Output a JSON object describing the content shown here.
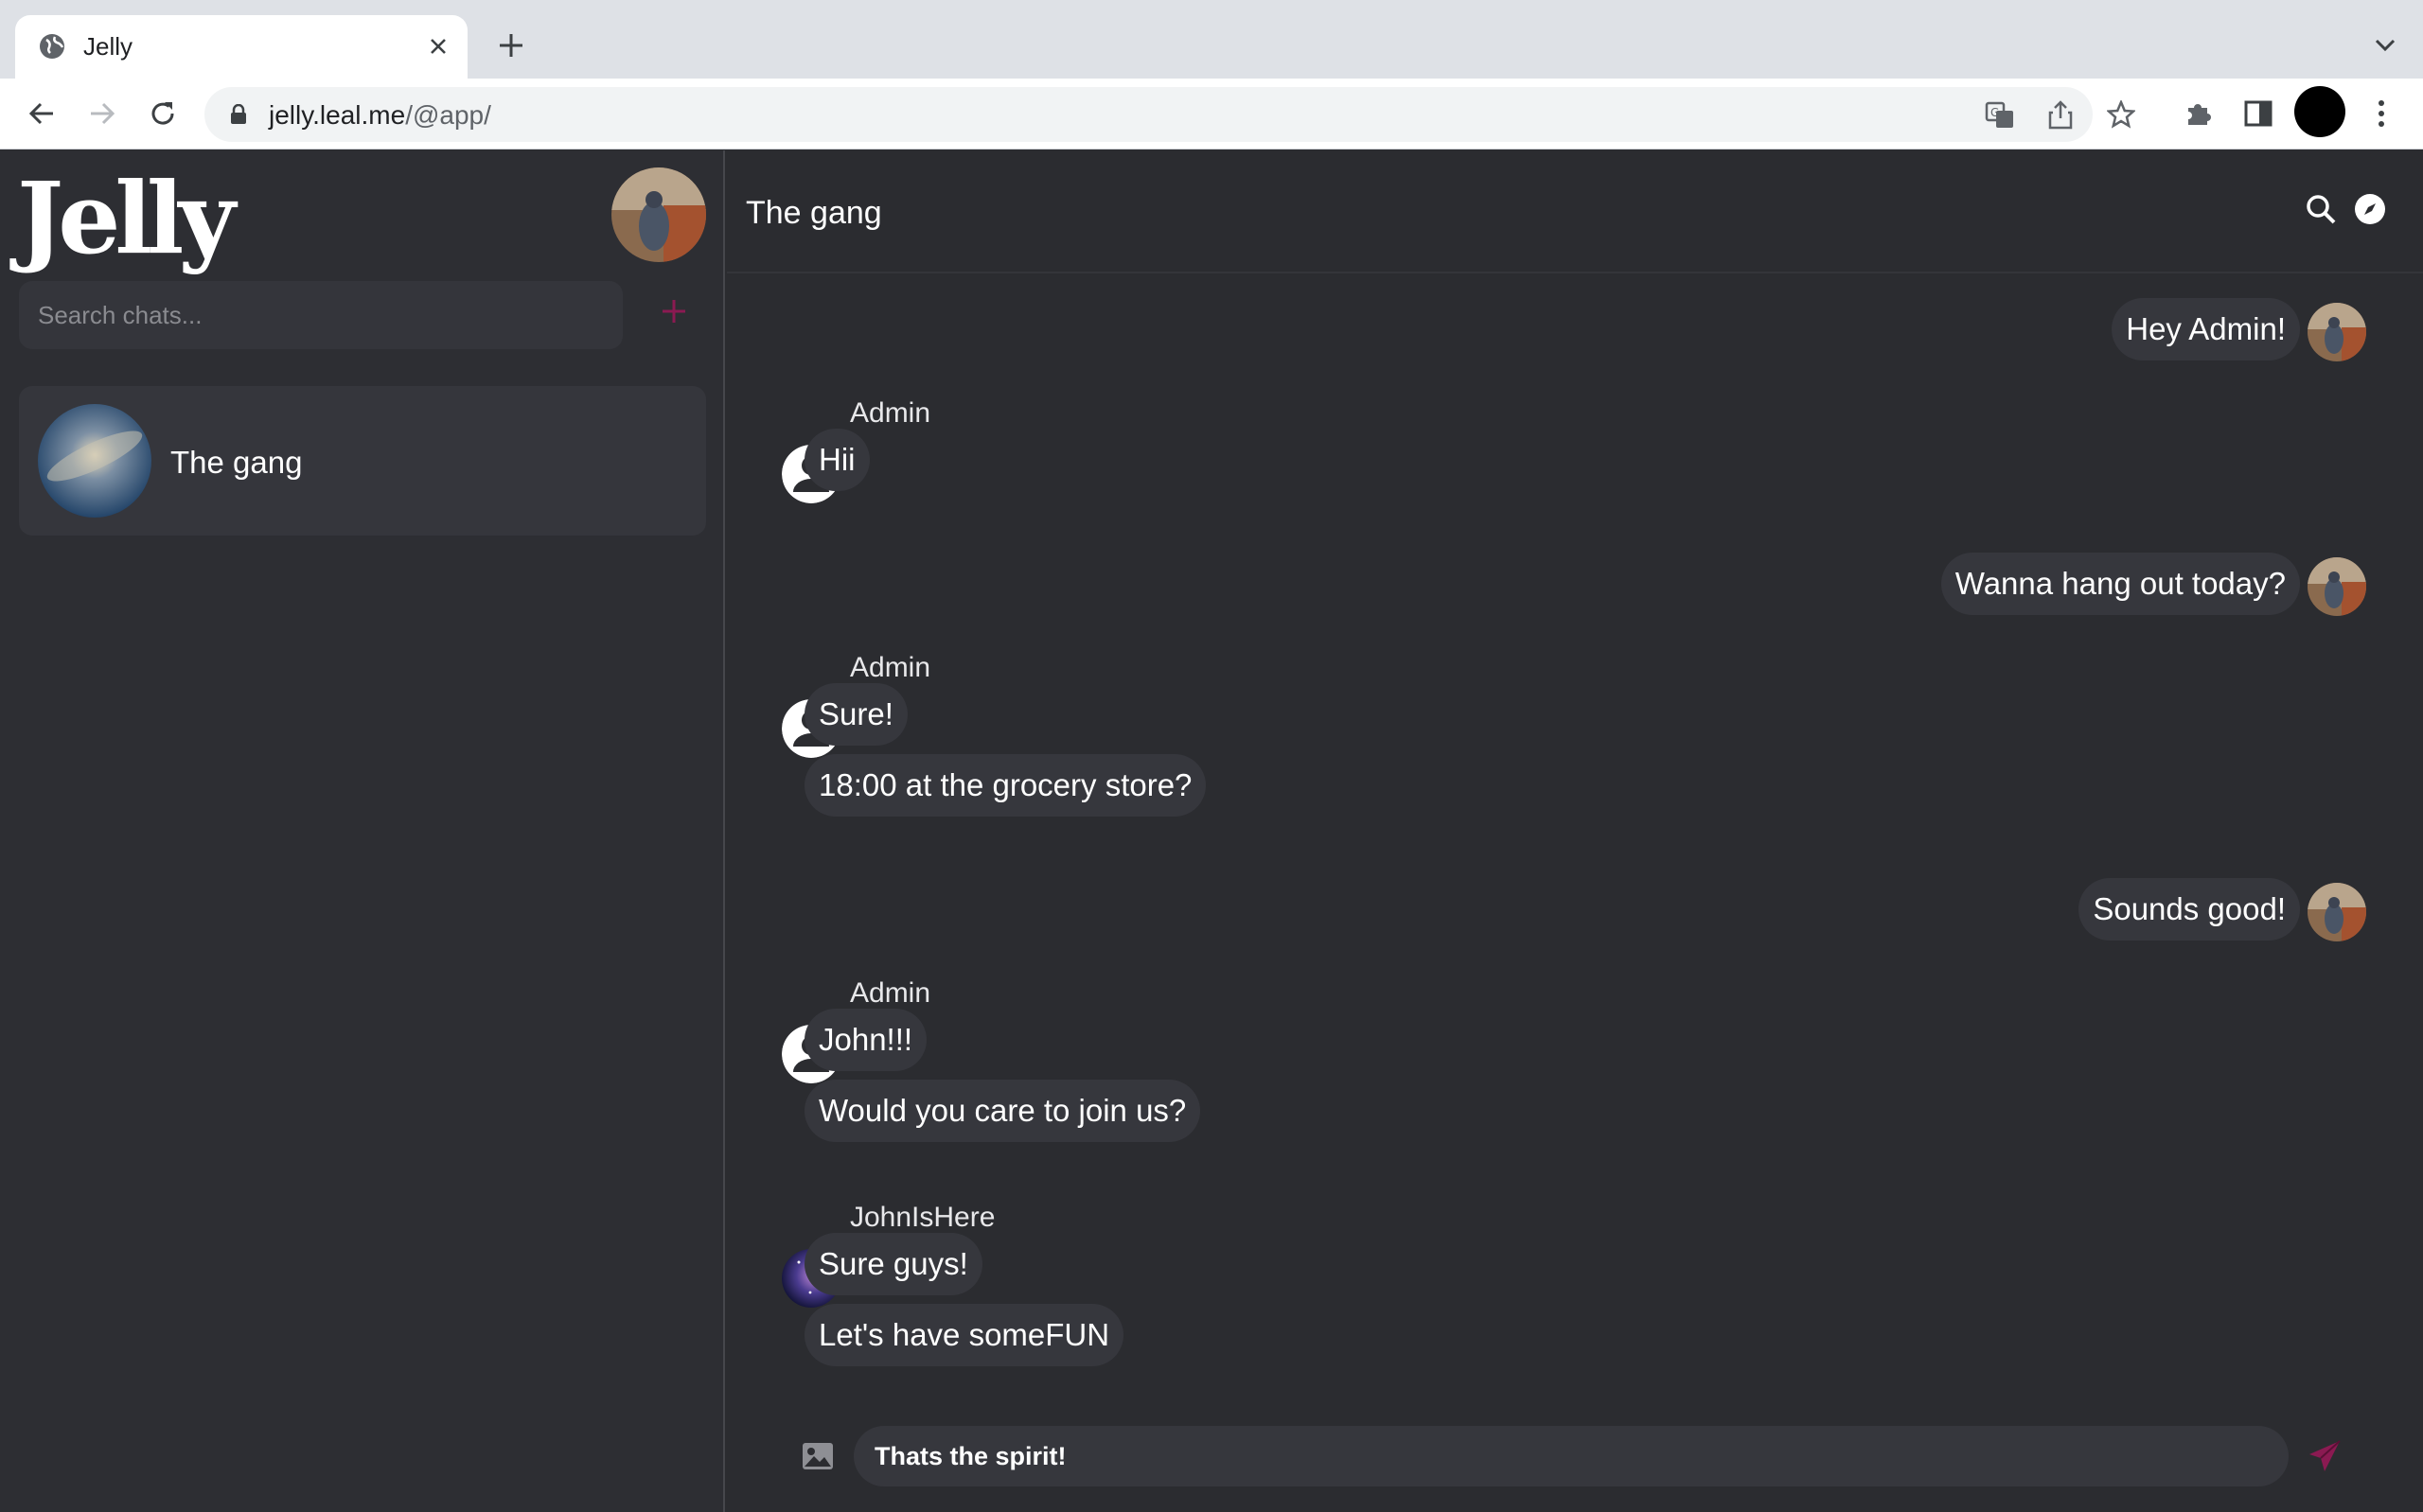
{
  "browser": {
    "tab_title": "Jelly",
    "url_host": "jelly.leal.me",
    "url_path": "/@app/"
  },
  "app": {
    "logo": "Jelly",
    "accent_color": "#8b1a52",
    "search": {
      "placeholder": "Search chats..."
    },
    "chats": [
      {
        "name": "The gang"
      }
    ]
  },
  "conversation": {
    "title": "The gang",
    "messages": [
      {
        "direction": "out",
        "text": "Hey Admin!"
      },
      {
        "direction": "in",
        "sender": "Admin",
        "lines": [
          "Hii"
        ]
      },
      {
        "direction": "out",
        "text": "Wanna hang out today?"
      },
      {
        "direction": "in",
        "sender": "Admin",
        "lines": [
          "Sure!",
          "18:00 at the grocery store?"
        ]
      },
      {
        "direction": "out",
        "text": "Sounds good!"
      },
      {
        "direction": "in",
        "sender": "Admin",
        "lines": [
          "John!!!",
          "Would you care to join us?"
        ]
      },
      {
        "direction": "in",
        "sender": "JohnIsHere",
        "lines": [
          "Sure guys!",
          "Let's have someFUN"
        ]
      }
    ],
    "composer_value": "Thats the spirit!"
  }
}
